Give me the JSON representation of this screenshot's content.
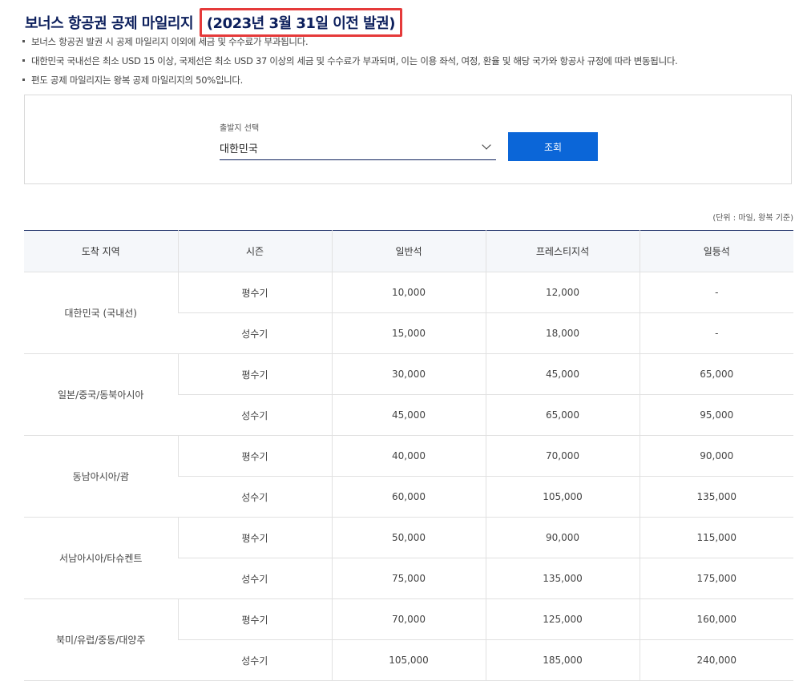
{
  "title": {
    "main": "보너스 항공권 공제 마일리지",
    "highlight": "(2023년 3월 31일 이전 발권)"
  },
  "notes": [
    "보너스 항공권 발권 시 공제 마일리지 이외에 세금 및 수수료가 부과됩니다.",
    "대한민국 국내선은 최소 USD 15 이상, 국제선은 최소 USD 37 이상의 세금 및 수수료가 부과되며, 이는 이용 좌석, 여정, 환율 및 해당 국가와 항공사 규정에 따라 변동됩니다.",
    "편도 공제 마일리지는 왕복 공제 마일리지의 50%입니다."
  ],
  "search": {
    "label": "출발지 선택",
    "selected": "대한민국",
    "button": "조회"
  },
  "unit_note": "(단위 : 마일, 왕복 기준)",
  "table": {
    "headers": [
      "도착 지역",
      "시즌",
      "일반석",
      "프레스티지석",
      "일등석"
    ],
    "regions": [
      {
        "name": "대한민국 (국내선)",
        "rows": [
          {
            "season": "평수기",
            "economy": "10,000",
            "prestige": "12,000",
            "first": "-"
          },
          {
            "season": "성수기",
            "economy": "15,000",
            "prestige": "18,000",
            "first": "-"
          }
        ]
      },
      {
        "name": "일본/중국/동북아시아",
        "rows": [
          {
            "season": "평수기",
            "economy": "30,000",
            "prestige": "45,000",
            "first": "65,000"
          },
          {
            "season": "성수기",
            "economy": "45,000",
            "prestige": "65,000",
            "first": "95,000"
          }
        ]
      },
      {
        "name": "동남아시아/괌",
        "rows": [
          {
            "season": "평수기",
            "economy": "40,000",
            "prestige": "70,000",
            "first": "90,000"
          },
          {
            "season": "성수기",
            "economy": "60,000",
            "prestige": "105,000",
            "first": "135,000"
          }
        ]
      },
      {
        "name": "서남아시아/타슈켄트",
        "rows": [
          {
            "season": "평수기",
            "economy": "50,000",
            "prestige": "90,000",
            "first": "115,000"
          },
          {
            "season": "성수기",
            "economy": "75,000",
            "prestige": "135,000",
            "first": "175,000"
          }
        ]
      },
      {
        "name": "북미/유럽/중동/대양주",
        "rows": [
          {
            "season": "평수기",
            "economy": "70,000",
            "prestige": "125,000",
            "first": "160,000"
          },
          {
            "season": "성수기",
            "economy": "105,000",
            "prestige": "185,000",
            "first": "240,000"
          }
        ]
      }
    ]
  },
  "colors": {
    "title": "#0c1f5c",
    "highlight_border": "#e53a3a",
    "button": "#0b66d8",
    "table_header_bg": "#f5f7fa"
  }
}
